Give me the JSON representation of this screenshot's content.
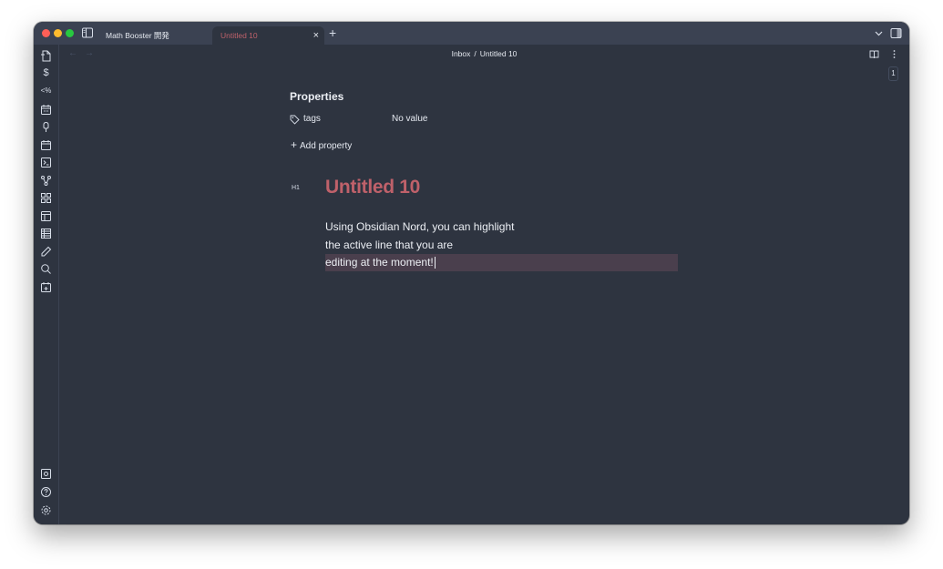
{
  "tabs": [
    {
      "label": "Math Booster 開発",
      "active": false
    },
    {
      "label": "Untitled 10",
      "active": true
    }
  ],
  "tab_close_glyph": "×",
  "new_tab_glyph": "+",
  "nav": {
    "back_glyph": "←",
    "forward_glyph": "→",
    "breadcrumb": [
      "Inbox",
      "Untitled 10"
    ],
    "breadcrumb_sep": "/"
  },
  "page_count": "1",
  "ribbon": {
    "icons": [
      "file-icon",
      "dollar-icon",
      "template-icon",
      "calendar-icon",
      "pin-icon",
      "calendar-day-icon",
      "terminal-icon",
      "graph-icon",
      "layout-icon",
      "table-icon",
      "list-icon",
      "pencil-icon",
      "search-icon",
      "daily-note-icon"
    ],
    "dollar_glyph": "$",
    "template_glyph": "<%",
    "bottom_icons": [
      "vault-icon",
      "help-icon",
      "settings-icon"
    ]
  },
  "properties": {
    "heading": "Properties",
    "items": [
      {
        "key": "tags",
        "value": "No value"
      }
    ],
    "add_label": "Add property",
    "add_glyph": "+"
  },
  "document": {
    "heading_level": "H1",
    "title": "Untitled 10",
    "lines": [
      "Using Obsidian Nord, you can highlight",
      "the active line that you are",
      "editing at the moment!"
    ]
  },
  "colors": {
    "background": "#2e3440",
    "titlebar": "#3b4252",
    "accent_red": "#bf616a",
    "active_line": "#4a3f4d",
    "text": "#eceff4"
  }
}
